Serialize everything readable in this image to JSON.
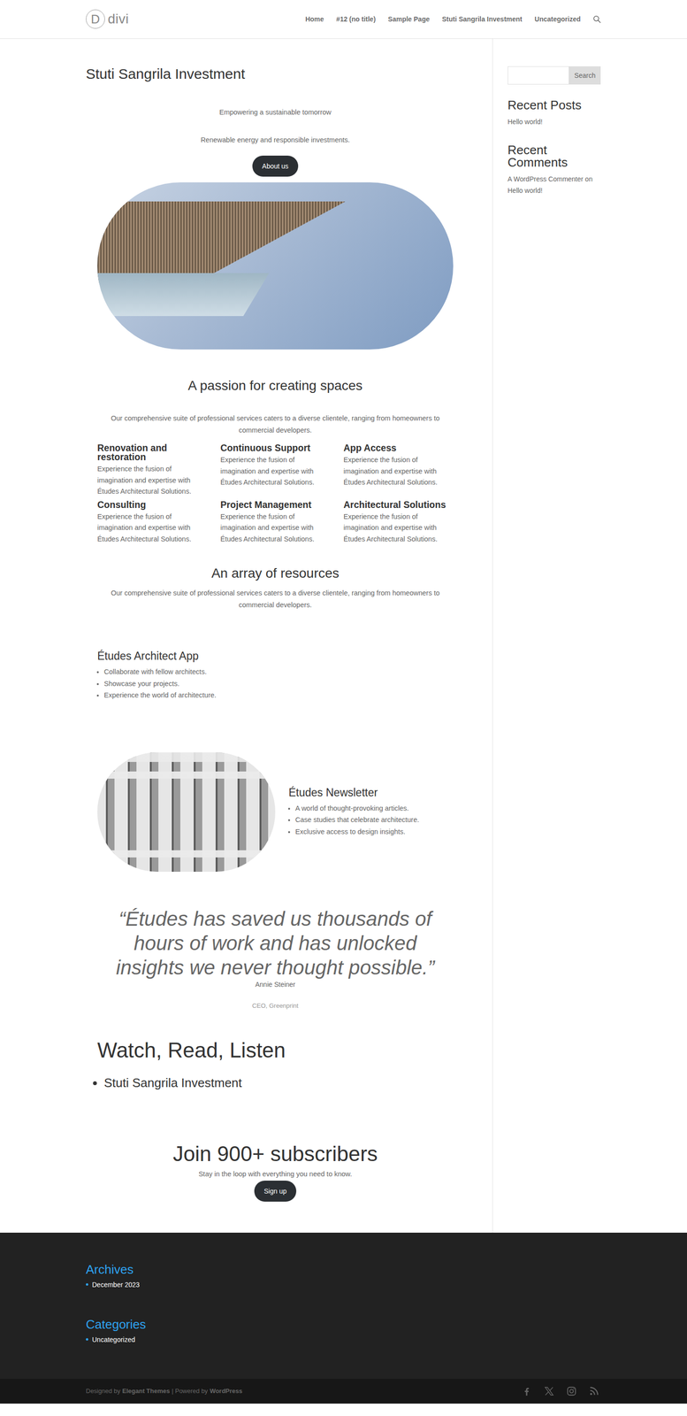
{
  "header": {
    "logo": {
      "mark": "D",
      "text": "divi"
    },
    "nav": [
      {
        "label": "Home"
      },
      {
        "label": "#12 (no title)"
      },
      {
        "label": "Sample Page"
      },
      {
        "label": "Stuti Sangrila Investment"
      },
      {
        "label": "Uncategorized"
      }
    ]
  },
  "page": {
    "title": "Stuti Sangrila Investment"
  },
  "hero": {
    "tagline": "Empowering a sustainable tomorrow",
    "subtitle": "Renewable energy and responsible investments.",
    "button": "About us"
  },
  "services": {
    "heading": "A passion for creating spaces",
    "intro": "Our comprehensive suite of professional services caters to a diverse clientele, ranging from homeowners to commercial developers.",
    "items": [
      {
        "title": "Renovation and restoration",
        "text": "Experience the fusion of imagination and expertise with Études Architectural Solutions."
      },
      {
        "title": "Continuous Support",
        "text": "Experience the fusion of imagination and expertise with Études Architectural Solutions."
      },
      {
        "title": "App Access",
        "text": "Experience the fusion of imagination and expertise with Études Architectural Solutions."
      },
      {
        "title": "Consulting",
        "text": "Experience the fusion of imagination and expertise with Études Architectural Solutions."
      },
      {
        "title": "Project Management",
        "text": "Experience the fusion of imagination and expertise with Études Architectural Solutions."
      },
      {
        "title": "Architectural Solutions",
        "text": "Experience the fusion of imagination and expertise with Études Architectural Solutions."
      }
    ]
  },
  "resources": {
    "heading": "An array of resources",
    "intro": "Our comprehensive suite of professional services caters to a diverse clientele, ranging from homeowners to commercial developers.",
    "app": {
      "title": "Études Architect App",
      "points": [
        "Collaborate with fellow architects.",
        "Showcase your projects.",
        "Experience the world of architecture."
      ]
    },
    "newsletter": {
      "title": "Études Newsletter",
      "points": [
        "A world of thought-provoking articles.",
        "Case studies that celebrate architecture.",
        "Exclusive access to design insights."
      ]
    }
  },
  "testimonial": {
    "quote": "“Études has saved us thousands of hours of work and has unlocked insights we never thought possible.”",
    "author": "Annie Steiner",
    "role": "CEO, Greenprint"
  },
  "media": {
    "heading": "Watch, Read, Listen",
    "items": [
      "Stuti Sangrila Investment"
    ]
  },
  "subscribe": {
    "heading": "Join 900+ subscribers",
    "text": "Stay in the loop with everything you need to know.",
    "button": "Sign up"
  },
  "sidebar": {
    "search": {
      "button": "Search"
    },
    "recent_posts": {
      "title": "Recent Posts",
      "items": [
        "Hello world!"
      ]
    },
    "recent_comments": {
      "title": "Recent Comments",
      "items": [
        {
          "author": "A WordPress Commenter",
          "connector": "on",
          "post": "Hello world!"
        }
      ]
    }
  },
  "footer": {
    "widgets": [
      {
        "title": "Archives",
        "items": [
          "December 2023"
        ]
      },
      {
        "title": "Categories",
        "items": [
          "Uncategorized"
        ]
      }
    ],
    "credits": {
      "prefix": "Designed by",
      "theme": "Elegant Themes",
      "separator": "| Powered by",
      "platform": "WordPress"
    }
  }
}
